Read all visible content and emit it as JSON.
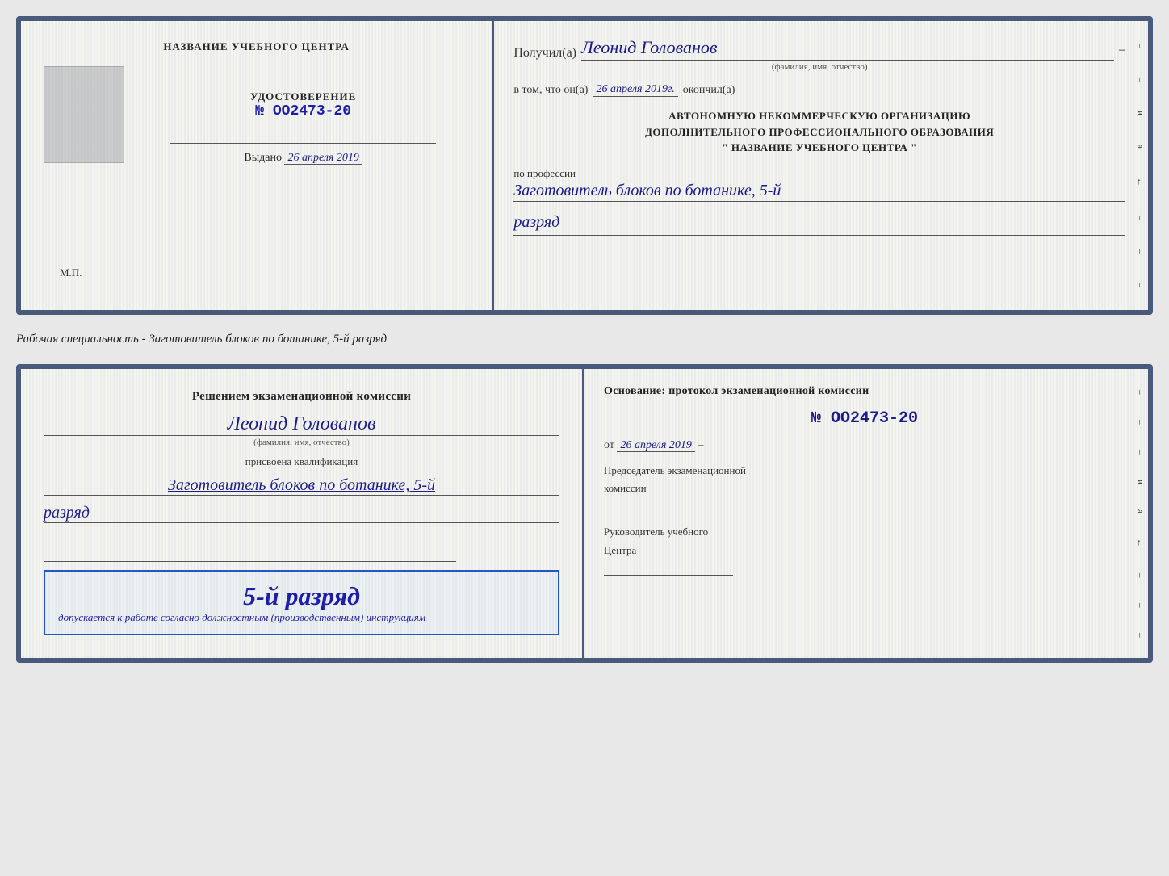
{
  "doc1": {
    "left": {
      "center_title": "НАЗВАНИЕ УЧЕБНОГО ЦЕНТРА",
      "cert_title": "УДОСТОВЕРЕНИЕ",
      "cert_number": "№ OO2473-20",
      "issued_label": "Выдано",
      "issued_date": "26 апреля 2019",
      "mp_label": "М.П."
    },
    "right": {
      "recipient_label": "Получил(а)",
      "recipient_name": "Леонид Голованов",
      "fio_hint": "(фамилия, имя, отчество)",
      "date_prefix": "в том, что он(а)",
      "date_value": "26 апреля 2019г.",
      "date_suffix": "окончил(а)",
      "org_line1": "АВТОНОМНУЮ НЕКОММЕРЧЕСКУЮ ОРГАНИЗАЦИЮ",
      "org_line2": "ДОПОЛНИТЕЛЬНОГО ПРОФЕССИОНАЛЬНОГО ОБРАЗОВАНИЯ",
      "org_line3": "\"   НАЗВАНИЕ УЧЕБНОГО ЦЕНТРА   \"",
      "profession_label": "по профессии",
      "profession_value": "Заготовитель блоков по ботанике, 5-й",
      "razryad_value": "разряд",
      "side_chars": [
        "–",
        "–",
        "и",
        "а",
        "←",
        "–",
        "–",
        "–"
      ]
    }
  },
  "middle_label": "Рабочая специальность - Заготовитель блоков по ботанике, 5-й разряд",
  "doc2": {
    "left": {
      "decision_text": "Решением экзаменационной комиссии",
      "person_name": "Леонид Голованов",
      "fio_hint": "(фамилия, имя, отчество)",
      "assigned_label": "присвоена квалификация",
      "qual_value": "Заготовитель блоков по ботанике, 5-й",
      "razryad_value": "разряд",
      "highlight_rank": "5-й разряд",
      "allowed_text": "допускается к работе согласно должностным (производственным) инструкциям"
    },
    "right": {
      "osnov_label": "Основание: протокол экзаменационной комиссии",
      "protocol_num": "№ OO2473-20",
      "from_label": "от",
      "from_date": "26 апреля 2019",
      "chairman_label1": "Председатель экзаменационной",
      "chairman_label2": "комиссии",
      "head_label1": "Руководитель учебного",
      "head_label2": "Центра",
      "side_chars": [
        "–",
        "–",
        "–",
        "и",
        "а",
        "←",
        "–",
        "–",
        "–"
      ]
    }
  }
}
